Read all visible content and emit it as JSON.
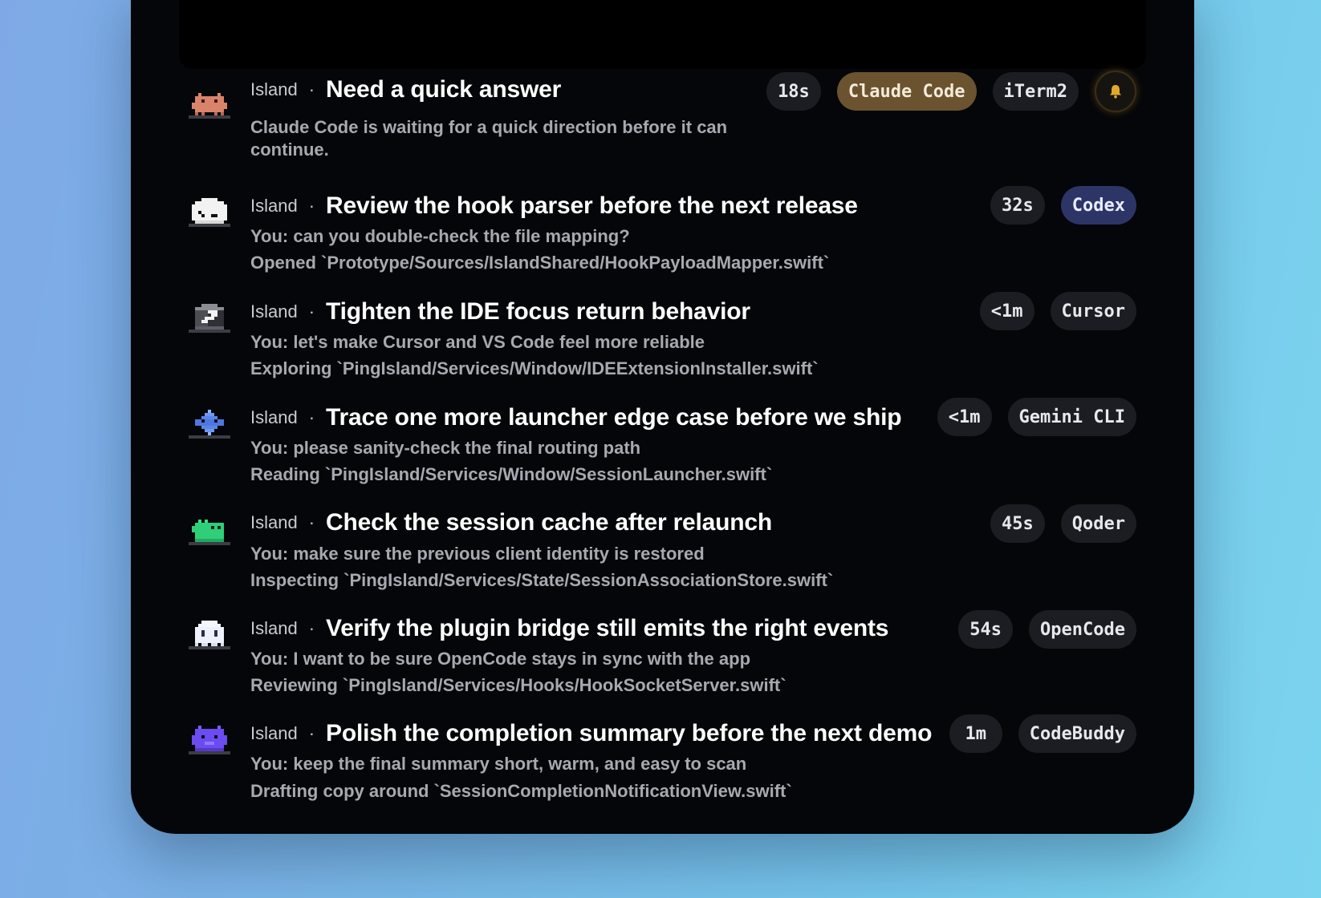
{
  "sessions": [
    {
      "source": "Island",
      "title": "Need a quick answer",
      "line1": "Claude Code is waiting for a quick direction before it can",
      "line2": "continue.",
      "time": "18s",
      "agent": "Claude Code",
      "terminal": "iTerm2",
      "avatar": "claude-crab-icon",
      "notify_icon": "bell-icon",
      "colors": {
        "agent_pill": "#6b5330",
        "bell": "#d9a520"
      }
    },
    {
      "source": "Island",
      "title": "Review the hook parser before the next release",
      "line1": "You: can you double-check the file mapping?",
      "line2": "Opened `Prototype/Sources/IslandShared/HookPayloadMapper.swift`",
      "time": "32s",
      "agent": "Codex",
      "avatar": "codex-cloud-icon",
      "colors": {
        "agent_pill": "#2c3565"
      }
    },
    {
      "source": "Island",
      "title": "Tighten the IDE focus return behavior",
      "line1": "You: let's make Cursor and VS Code feel more reliable",
      "line2": "Exploring `PingIsland/Services/Window/IDEExtensionInstaller.swift`",
      "time": "<1m",
      "agent": "Cursor",
      "avatar": "cursor-cube-icon"
    },
    {
      "source": "Island",
      "title": "Trace one more launcher edge case before we ship",
      "line1": "You: please sanity-check the final routing path",
      "line2": "Reading `PingIsland/Services/Window/SessionLauncher.swift`",
      "time": "<1m",
      "agent": "Gemini CLI",
      "avatar": "gemini-star-icon"
    },
    {
      "source": "Island",
      "title": "Check the session cache after relaunch",
      "line1": "You: make sure the previous client identity is restored",
      "line2": "Inspecting `PingIsland/Services/State/SessionAssociationStore.swift`",
      "time": "45s",
      "agent": "Qoder",
      "avatar": "qoder-blob-icon"
    },
    {
      "source": "Island",
      "title": "Verify the plugin bridge still emits the right events",
      "line1": "You: I want to be sure OpenCode stays in sync with the app",
      "line2": "Reviewing `PingIsland/Services/Hooks/HookSocketServer.swift`",
      "time": "54s",
      "agent": "OpenCode",
      "avatar": "opencode-ghost-icon"
    },
    {
      "source": "Island",
      "title": "Polish the completion summary before the next demo",
      "line1": "You: keep the final summary short, warm, and easy to scan",
      "line2": "Drafting copy around `SessionCompletionNotificationView.swift`",
      "time": "1m",
      "agent": "CodeBuddy",
      "avatar": "codebuddy-robot-icon"
    }
  ]
}
